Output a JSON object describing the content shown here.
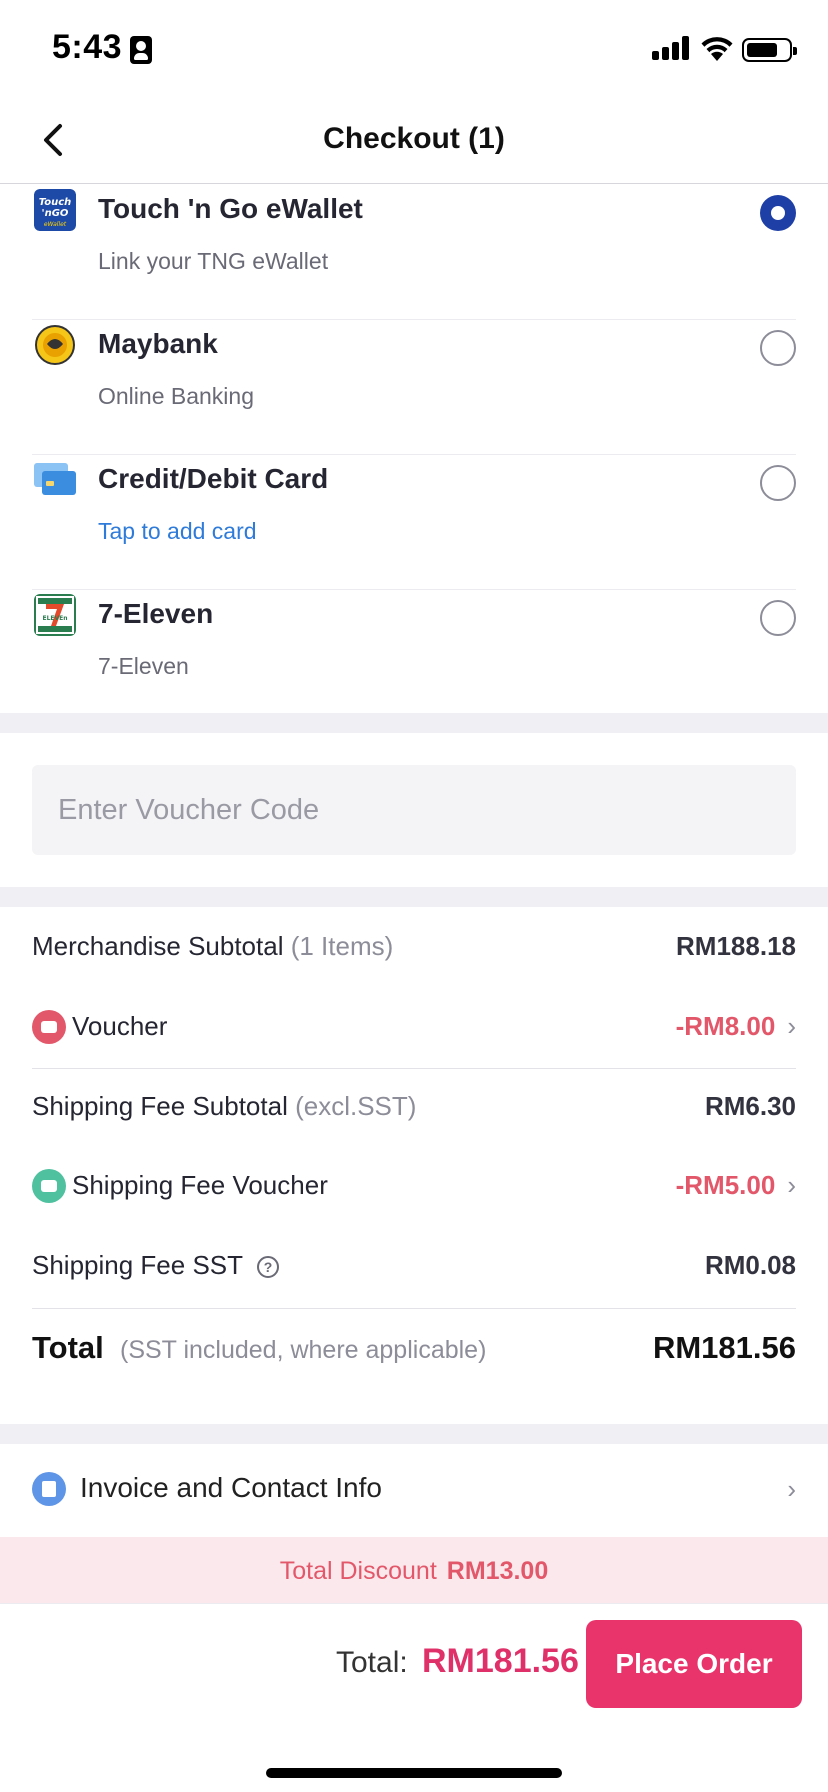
{
  "status_bar": {
    "time": "5:43"
  },
  "header": {
    "title": "Checkout (1)"
  },
  "payment_methods": [
    {
      "name": "Touch 'n Go eWallet",
      "sub": "Link your TNG eWallet",
      "selected": true,
      "icon": "tng-logo"
    },
    {
      "name": "Maybank",
      "sub": "Online Banking",
      "selected": false,
      "icon": "maybank-logo"
    },
    {
      "name": "Credit/Debit Card",
      "sub": "Tap to add card",
      "selected": false,
      "icon": "card-icon"
    },
    {
      "name": "7-Eleven",
      "sub": "7-Eleven",
      "selected": false,
      "icon": "seven-eleven-logo"
    }
  ],
  "voucher_input": {
    "placeholder": "Enter Voucher Code"
  },
  "summary": {
    "merchandise_label": "Merchandise Subtotal",
    "merchandise_note": "(1 Items)",
    "merchandise_value": "RM188.18",
    "voucher_label": "Voucher",
    "voucher_value": "-RM8.00",
    "shipping_label": "Shipping Fee Subtotal",
    "shipping_note": "(excl.SST)",
    "shipping_value": "RM6.30",
    "shipping_voucher_label": "Shipping Fee Voucher",
    "shipping_voucher_value": "-RM5.00",
    "sst_label": "Shipping Fee SST",
    "sst_value": "RM0.08",
    "total_label": "Total",
    "total_note": "(SST included, where applicable)",
    "total_value": "RM181.56"
  },
  "invoice": {
    "label": "Invoice and Contact Info"
  },
  "discount": {
    "label": "Total Discount",
    "value": "RM13.00"
  },
  "footer": {
    "total_label": "Total:",
    "total_value": "RM181.56",
    "button_label": "Place Order"
  },
  "colors": {
    "accent": "#e8336b",
    "discount_red": "#e2586a",
    "link_blue": "#2f7bd9",
    "radio_selected": "#1e3fa6"
  }
}
